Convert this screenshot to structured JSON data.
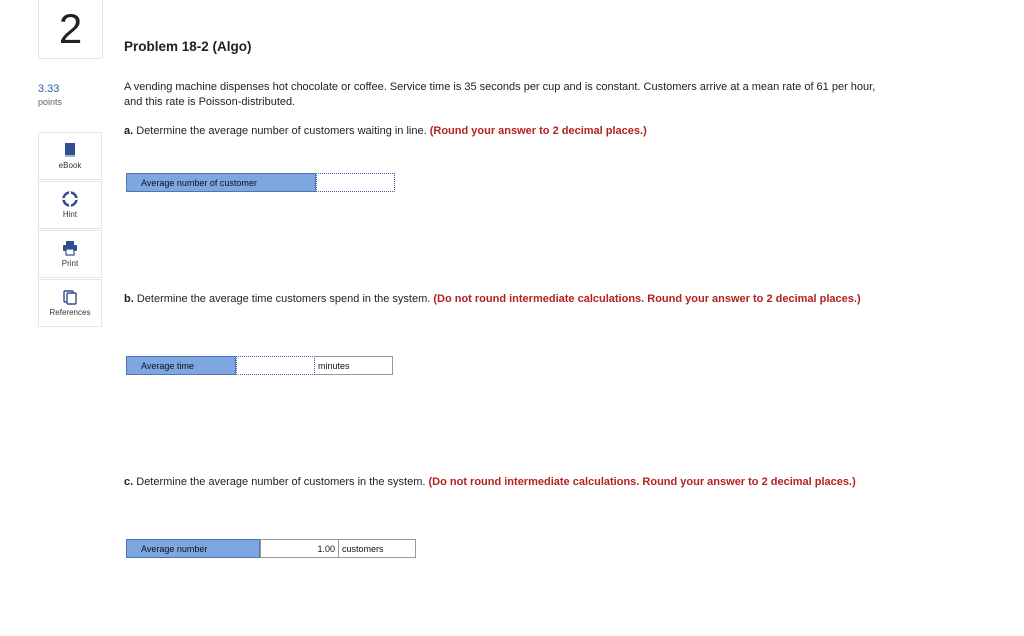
{
  "question": {
    "number": "2",
    "points_value": "3.33",
    "points_label": "points"
  },
  "tools": [
    {
      "label": "eBook",
      "icon": "book-icon"
    },
    {
      "label": "Hint",
      "icon": "lifebuoy-icon"
    },
    {
      "label": "Print",
      "icon": "printer-icon"
    },
    {
      "label": "References",
      "icon": "documents-icon"
    }
  ],
  "problem": {
    "title": "Problem 18-2 (Algo)",
    "intro": "A vending machine dispenses hot chocolate or coffee. Service time is 35 seconds per cup and is constant. Customers arrive at a mean rate of 61 per hour, and this rate is Poisson-distributed."
  },
  "part_a": {
    "letter": "a.",
    "text": " Determine the average number of customers waiting in line. ",
    "note": "(Round your answer to 2 decimal places.)",
    "label": "Average number of customer",
    "value": ""
  },
  "part_b": {
    "letter": "b.",
    "text": " Determine the average time customers spend in the system. ",
    "note": "(Do not round intermediate calculations. Round your answer to 2 decimal places.)",
    "label": "Average time",
    "value": "",
    "unit": "minutes"
  },
  "part_c": {
    "letter": "c.",
    "text": " Determine the average number of customers in the system. ",
    "note": "(Do not round intermediate calculations. Round your answer to 2 decimal places.)",
    "label": "Average number",
    "value": "1.00",
    "unit": "customers"
  },
  "colors": {
    "link_blue": "#2a5db0",
    "instruction_red": "#b52121",
    "label_fill": "#7ea6e0",
    "label_border": "#4f77b5"
  }
}
